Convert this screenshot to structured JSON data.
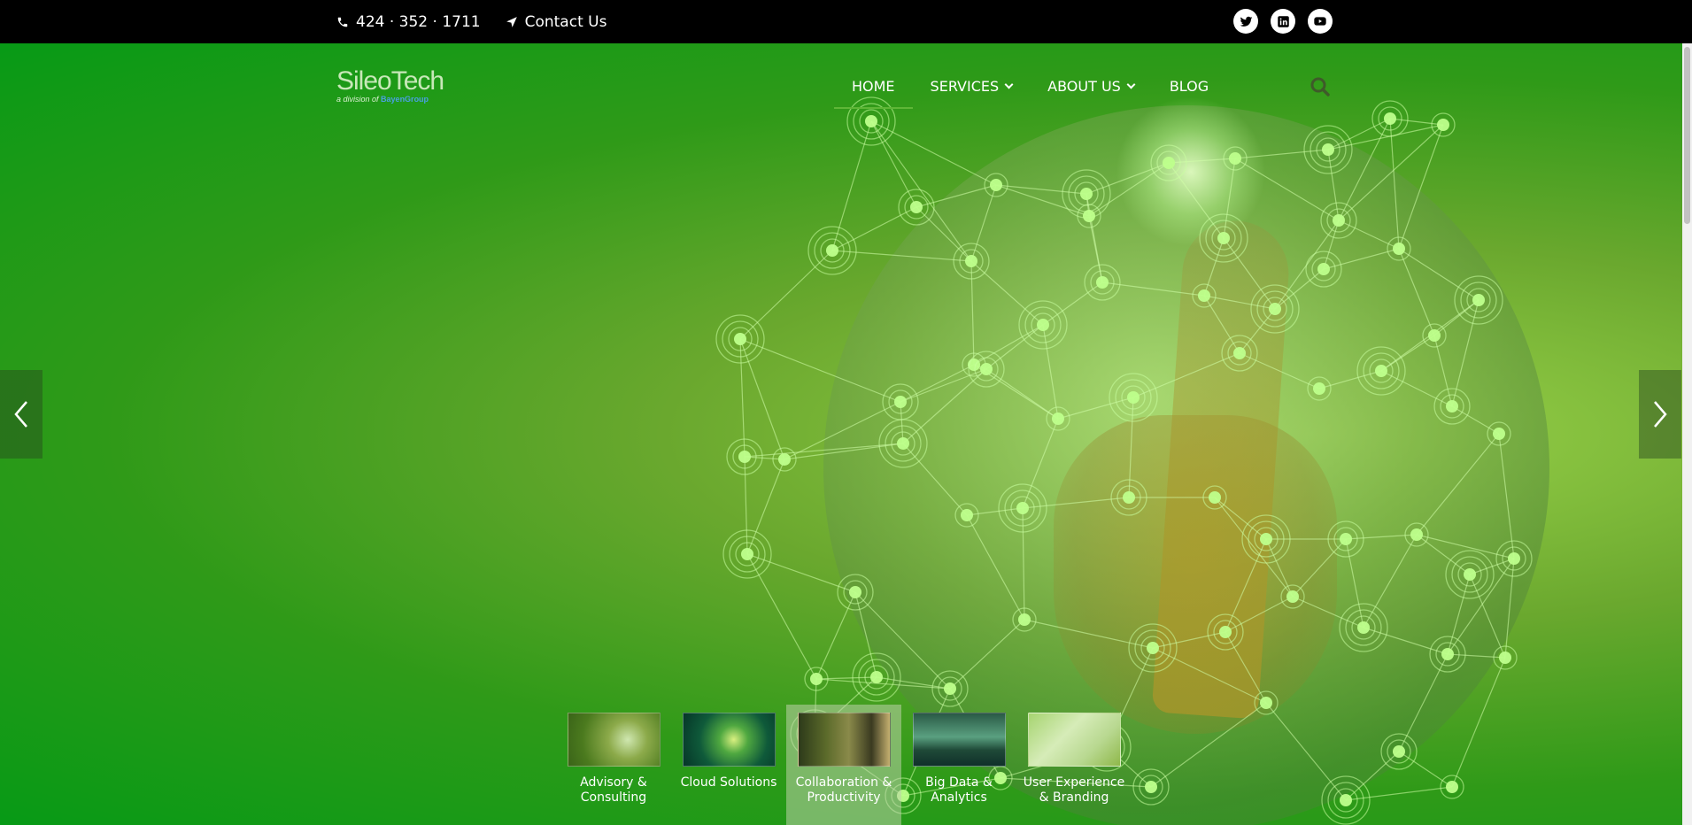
{
  "topbar": {
    "phone": "424 · 352 · 1711",
    "contact_label": "Contact Us",
    "socials": [
      "twitter-icon",
      "linkedin-icon",
      "youtube-icon"
    ]
  },
  "logo": {
    "name": "SileoTech",
    "subtitle_prefix": "a division of",
    "subtitle_brand": "BayenGroup"
  },
  "nav": {
    "items": [
      {
        "label": "HOME",
        "active": true,
        "dropdown": false
      },
      {
        "label": "SERVICES",
        "active": false,
        "dropdown": true
      },
      {
        "label": "ABOUT US",
        "active": false,
        "dropdown": true
      },
      {
        "label": "BLOG",
        "active": false,
        "dropdown": false
      }
    ]
  },
  "slider": {
    "thumbnails": [
      {
        "label": "Advisory & Consulting",
        "active": false
      },
      {
        "label": "Cloud Solutions",
        "active": false
      },
      {
        "label": "Collaboration & Productivity",
        "active": true
      },
      {
        "label": "Big Data & Analytics",
        "active": false
      },
      {
        "label": "User Experience & Branding",
        "active": false
      }
    ]
  },
  "colors": {
    "accent": "#5fb637",
    "hero_green": "#079a16",
    "topbar": "#000000"
  }
}
